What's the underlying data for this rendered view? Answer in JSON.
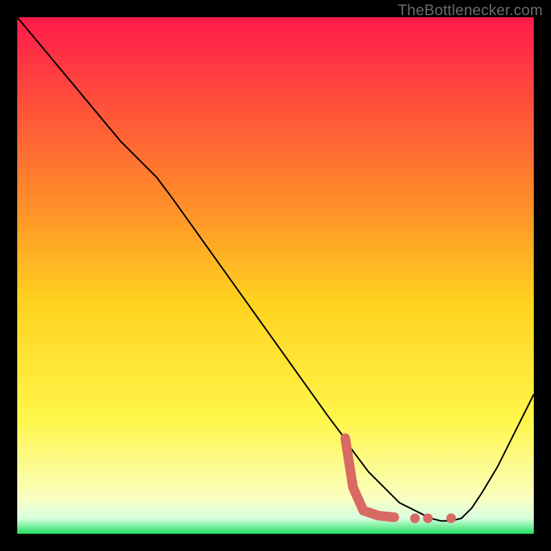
{
  "watermark": "TheBottlenecker.com",
  "colors": {
    "frame": "#000000",
    "curve": "#000000",
    "marker": "#d86a63",
    "gradient_top": "#ff1a4b",
    "gradient_mid_upper": "#ff8a2a",
    "gradient_mid": "#ffd21f",
    "gradient_mid_lower": "#fff64a",
    "gradient_pale": "#fbffc0",
    "gradient_green": "#23e063"
  },
  "chart_data": {
    "type": "line",
    "title": "",
    "xlabel": "",
    "ylabel": "",
    "xlim": [
      0,
      100
    ],
    "ylim": [
      0,
      100
    ],
    "series": [
      {
        "name": "bottleneck-curve",
        "x": [
          0,
          5,
          10,
          15,
          20,
          25,
          27,
          30,
          35,
          40,
          45,
          50,
          55,
          60,
          63,
          65,
          68,
          70,
          72,
          74,
          76,
          78,
          80,
          82,
          84,
          86,
          88,
          90,
          93,
          96,
          100
        ],
        "y": [
          100,
          94,
          88,
          82,
          76,
          71,
          69,
          65,
          58,
          51,
          44,
          37,
          30,
          23,
          19,
          16,
          12,
          10,
          8,
          6,
          5,
          4,
          3,
          2.5,
          2.5,
          3,
          5,
          8,
          13,
          19,
          27
        ]
      }
    ],
    "markers": [
      {
        "name": "segment-start",
        "x": 63.5,
        "y": 18.5
      },
      {
        "name": "segment-a",
        "x": 65,
        "y": 9
      },
      {
        "name": "segment-b",
        "x": 67,
        "y": 4.5
      },
      {
        "name": "segment-c",
        "x": 70,
        "y": 3.5
      },
      {
        "name": "segment-d",
        "x": 73,
        "y": 3.2
      },
      {
        "name": "dot-e",
        "x": 77,
        "y": 3.0
      },
      {
        "name": "dot-f",
        "x": 79.5,
        "y": 3.0
      },
      {
        "name": "dot-g",
        "x": 84,
        "y": 3.0
      }
    ],
    "annotations": []
  }
}
